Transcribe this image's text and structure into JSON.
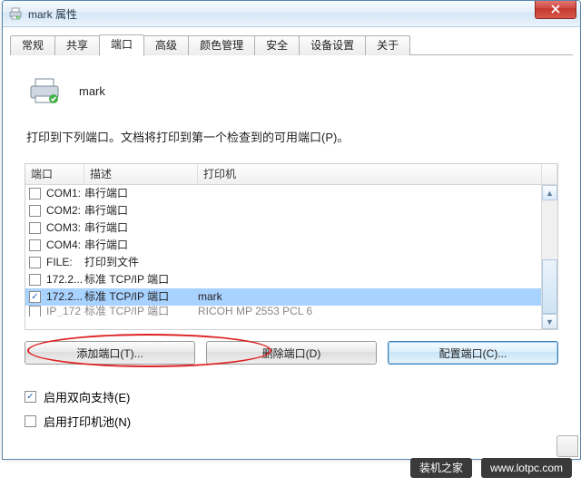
{
  "window": {
    "title": "mark 属性"
  },
  "tabs": [
    "常规",
    "共享",
    "端口",
    "高级",
    "颜色管理",
    "安全",
    "设备设置",
    "关于"
  ],
  "active_tab_index": 2,
  "printer_name": "mark",
  "instruction": "打印到下列端口。文档将打印到第一个检查到的可用端口(P)。",
  "columns": {
    "port": "端口",
    "desc": "描述",
    "printer": "打印机"
  },
  "ports": [
    {
      "checked": false,
      "port": "COM1:",
      "desc": "串行端口",
      "printer": ""
    },
    {
      "checked": false,
      "port": "COM2:",
      "desc": "串行端口",
      "printer": ""
    },
    {
      "checked": false,
      "port": "COM3:",
      "desc": "串行端口",
      "printer": ""
    },
    {
      "checked": false,
      "port": "COM4:",
      "desc": "串行端口",
      "printer": ""
    },
    {
      "checked": false,
      "port": "FILE:",
      "desc": "打印到文件",
      "printer": ""
    },
    {
      "checked": false,
      "port": "172.2...",
      "desc": "标准 TCP/IP 端口",
      "printer": ""
    },
    {
      "checked": true,
      "port": "172.2...",
      "desc": "标准 TCP/IP 端口",
      "printer": "mark"
    },
    {
      "checked": false,
      "port": "IP_172",
      "desc": "标准 TCP/IP 端口",
      "printer": "RICOH MP 2553 PCL 6"
    }
  ],
  "selected_port_index": 6,
  "buttons": {
    "add": "添加端口(T)...",
    "delete": "删除端口(D)",
    "config": "配置端口(C)..."
  },
  "checkboxes": {
    "bidi": {
      "checked": true,
      "label": "启用双向支持(E)"
    },
    "pool": {
      "checked": false,
      "label": "启用打印机池(N)"
    }
  },
  "watermarks": {
    "a": "装机之家",
    "b": "www.lotpc.com"
  }
}
